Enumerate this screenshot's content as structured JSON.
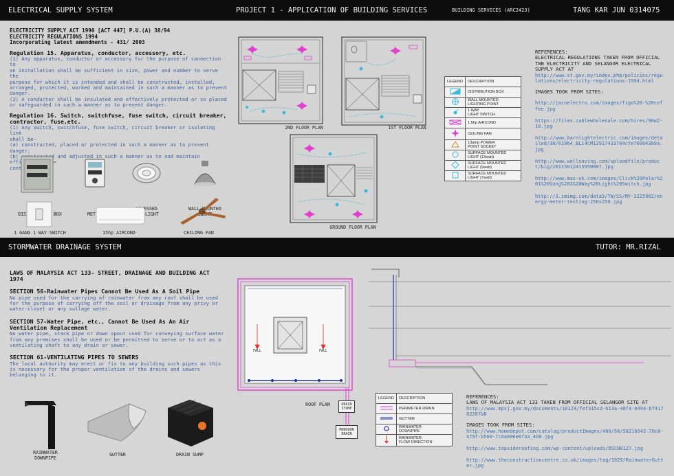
{
  "header": {
    "left": "ELECTRICAL SUPPLY SYSTEM",
    "center": "PROJECT 1 - APPLICATION OF BUILDING SERVICES",
    "center_small": "BUILDING SERVICES (ARC2423)",
    "right": "TANG KAR JUN 0314075"
  },
  "electrical": {
    "act_lines": [
      "ELECTRICITY SUPPLY ACT 1990 [ACT 447] P.U.(A) 38/94",
      "ELECTRICITY REGULATIONS 1994",
      "Incorporating latest amendments - 431/ 2003"
    ],
    "reg15_title": "Regulation 15. Apparatus, conductor, accessory, etc.",
    "reg15_body": [
      "(1) Any apparatus, conductor or accessory for the purpose of connection to",
      "an installation shall be sufficient in size, power and number to serve the",
      "purpose for which it is intended and shall be constructed, installed,",
      "arranged, protected, worked and maintained in such a manner as to prevent",
      "danger.",
      "(2) A conductor shall be insulated and effectively protected or so placed",
      "or safeguarded in such a manner as to prevent danger."
    ],
    "reg16_title": [
      "Regulation 16. Switch, switchfuse, fuse switch, circuit breaker,",
      "contractor, fuse,etc."
    ],
    "reg16_body": [
      "(1) Any switch, switchfuse, fuse switch, circuit breaker or isolating link",
      "shall be—",
      "(a) constructed, placed or protected in such a manner as to prevent",
      "danger;",
      "(b) constructed and adjusted in such a manner as to and maintain efficient",
      "contact;"
    ],
    "items": [
      {
        "label": "DISTRIBUTION BOX"
      },
      {
        "label": "METER"
      },
      {
        "label": "RECESSED\nDOWNLIGHT"
      },
      {
        "label": "WALL MOUNTED\nLIGHT"
      },
      {
        "label": "1 GANG 1 WAY SWITCH"
      },
      {
        "label": "15hp AIRCOND"
      },
      {
        "label": "CEILING FAN"
      }
    ],
    "plans": {
      "second": "2ND FLOOR PLAN",
      "first": "1ST FLOOR PLAN",
      "ground": "GROUND FLOOR PLAN"
    },
    "legend": {
      "head_legend": "LEGEND",
      "head_desc": "DESCRIPTION",
      "rows": [
        {
          "desc": "DISTRIBUTION BOX",
          "icon": "distribution-box-symbol"
        },
        {
          "desc": "WALL MOUNTED\nLIGHTING POINT",
          "icon": "wall-light-symbol"
        },
        {
          "desc": "1 WAY\nLIGHT SWITCH",
          "icon": "light-switch-symbol"
        },
        {
          "desc": "1.5hp AIRCOND",
          "icon": "aircond-symbol"
        },
        {
          "desc": "CEILING FAN",
          "icon": "ceiling-fan-symbol"
        },
        {
          "desc": "13amp POWER\nPOINT SOCKET",
          "icon": "socket-symbol"
        },
        {
          "desc": "SURFACE MOUNTED\nLIGHT (13watt)",
          "icon": "light-13w-symbol"
        },
        {
          "desc": "SURFACE MOUNTED\nLIGHT (9watt)",
          "icon": "light-9w-symbol"
        },
        {
          "desc": "SURFACE MOUNTED\nLIGHT (7watt)",
          "icon": "light-7w-symbol"
        }
      ]
    },
    "refs_title": "REFERENCES:",
    "refs_body": "ELECTRICAL REGULATIONS TAKEN FROM OFFICIAL TNB ELECTRICITY AND SELANGOR ELECTRICAL SUPPLY ACT AT",
    "refs_link": "http://www.st.gov.my/index.php/policies/regulations/electricity-regulations-1994.html",
    "images_title": "IMAGES TOOK FROM SITES:",
    "image_links": [
      "http://jainelectro.com/images/figo%20-%20coffee.jpg",
      "https://files.cablewholesale.com/hires/90w2-18.jpg",
      "http://www.barnlightelectric.com/images/detailed/30/61964_BL14CM12917433764cfe70904389a.jpg",
      "http://www.wellsaving.com/uploadfile/product/big/20115812415950087.jpg",
      "http://www.mas-uk.com/images/Click%20Polar%201%20Gang%202%20Way%20Light%20Switch.jpg",
      "http://3.imimg.com/data3/TW/SS/MY-3225902/energy-meter-testing-250x250.jpg"
    ]
  },
  "stormwater": {
    "band_left": "STORMWATER DRAINAGE SYSTEM",
    "band_right": "TUTOR: MR.RIZAL",
    "act_title": [
      "LAWS OF MALAYSIA ACT 133- STREET, DRAINAGE AND BUILDING ACT",
      "1974"
    ],
    "s56_title": "SECTION 56-Rainwater Pipes Cannot Be Used As A Soil Pipe",
    "s56_body": [
      "No pipe used for the carrying of rainwater from any roof shall be used",
      "for the purpose of carrying off the soil or drainage from any privy or",
      "water-closet or any sullage water."
    ],
    "s57_title": [
      "SECTION 57-Water Pipe, etc., Cannot Be Used As An Air",
      "Ventilation Replacement"
    ],
    "s57_body": [
      "No water pipe, stack pipe or down spout used for conveying surface water",
      "from any premises shall be used or be permitted to serve or to act as a",
      "ventilating shaft to any drain or sewer."
    ],
    "s61_title": "SECTION 61-VENTILATING PIPES TO SEWERS",
    "s61_body": [
      "The local authority may erect or fix to any building such pipes as this",
      "is necessary for the proper ventilation of the drains and sewers",
      "belonging to it."
    ],
    "items": [
      {
        "label": "RAINWATER\nDOWNPIPE"
      },
      {
        "label": "GUTTER"
      },
      {
        "label": "DRAIN SUMP"
      }
    ],
    "roof_plan": "ROOF PLAN",
    "fall": "FALL",
    "drain_stump": "DRAIN\nSTUMP",
    "monsoon_drain": "MONSOON\nDRAIN",
    "legend": {
      "head_legend": "LEGEND",
      "head_desc": "DESCRIPTION",
      "rows": [
        {
          "desc": "PERIMETER DRAIN",
          "icon": "perimeter-drain-symbol"
        },
        {
          "desc": "GUTTER",
          "icon": "gutter-symbol"
        },
        {
          "desc": "RAINWATER\nDOWNPIPE",
          "icon": "downpipe-symbol"
        },
        {
          "desc": "RAINWATER\nFLOW DIRECTION",
          "icon": "flow-arrow-symbol"
        }
      ]
    },
    "refs_title": "REFERENCES:",
    "refs_body": "LAWS OF MALAYSIA ACT 133 TAKEN FROM OFFICIAL SELANGOR SITE AT",
    "refs_link": "http://www.mpsj.gov.my/documents/10124/fef315cd-b13a-48f4-8494-bf41702287b8",
    "images_title": "IMAGES TOOK FROM SITES:",
    "image_links": [
      "http://www.homedepot.com/catalog/productImages/400/58/5821b542-70c8-479f-b560-7c0a606e6f3a_400.jpg",
      "http://www.topsideroofing.com/wp-content/uploads/DSCN0127.jpg",
      "http://www.theconstructioncentre.co.uk/images/tag/1029/RainwaterGutter.jpg"
    ]
  },
  "colors": {
    "band": "#0d0d0d",
    "link": "#3b6fb0",
    "magenta": "#e040d0",
    "cyan": "#3fb8d8",
    "drain_blue": "#2030a0"
  }
}
